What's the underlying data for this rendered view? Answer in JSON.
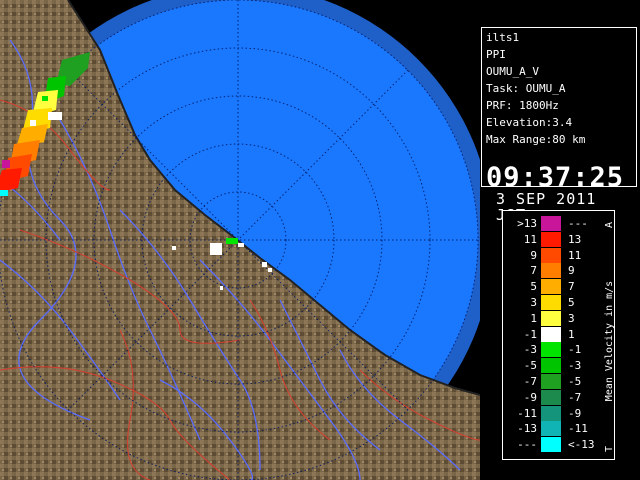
{
  "info": {
    "lines": [
      "ilts1",
      "PPI",
      "OUMU_A_V",
      "Task: OUMU_A",
      "PRF: 1800Hz",
      "Elevation:3.4",
      "Max Range:80 km"
    ],
    "time": "09:37:25",
    "date": "3 SEP 2011 JST"
  },
  "legend": {
    "title": "Mean Velocity in m/s",
    "top_marker": "A",
    "bottom_marker": "T",
    "unit": "m/s",
    "rows": [
      {
        "left": ">13",
        "right": "---",
        "color": "#c8159a"
      },
      {
        "left": "11",
        "right": "13",
        "color": "#ff1a00"
      },
      {
        "left": "9",
        "right": "11",
        "color": "#ff4a00"
      },
      {
        "left": "7",
        "right": "9",
        "color": "#ff7e00"
      },
      {
        "left": "5",
        "right": "7",
        "color": "#ffae00"
      },
      {
        "left": "3",
        "right": "5",
        "color": "#ffdc00"
      },
      {
        "left": "1",
        "right": "3",
        "color": "#ffff40"
      },
      {
        "left": "-1",
        "right": "1",
        "color": "#ffffff"
      },
      {
        "left": "-3",
        "right": "-1",
        "color": "#00e400"
      },
      {
        "left": "-5",
        "right": "-3",
        "color": "#00c400"
      },
      {
        "left": "-7",
        "right": "-5",
        "color": "#20a020"
      },
      {
        "left": "-9",
        "right": "-7",
        "color": "#1c8a4c"
      },
      {
        "left": "-11",
        "right": "-9",
        "color": "#14947a"
      },
      {
        "left": "-13",
        "right": "-11",
        "color": "#10b4b4"
      },
      {
        "left": "---",
        "right": "<-13",
        "color": "#00ffff"
      }
    ]
  },
  "map": {
    "sea_color": "#1a78ff",
    "land_color": "#7a6648",
    "range_ring_color": "#1f5fc8"
  }
}
